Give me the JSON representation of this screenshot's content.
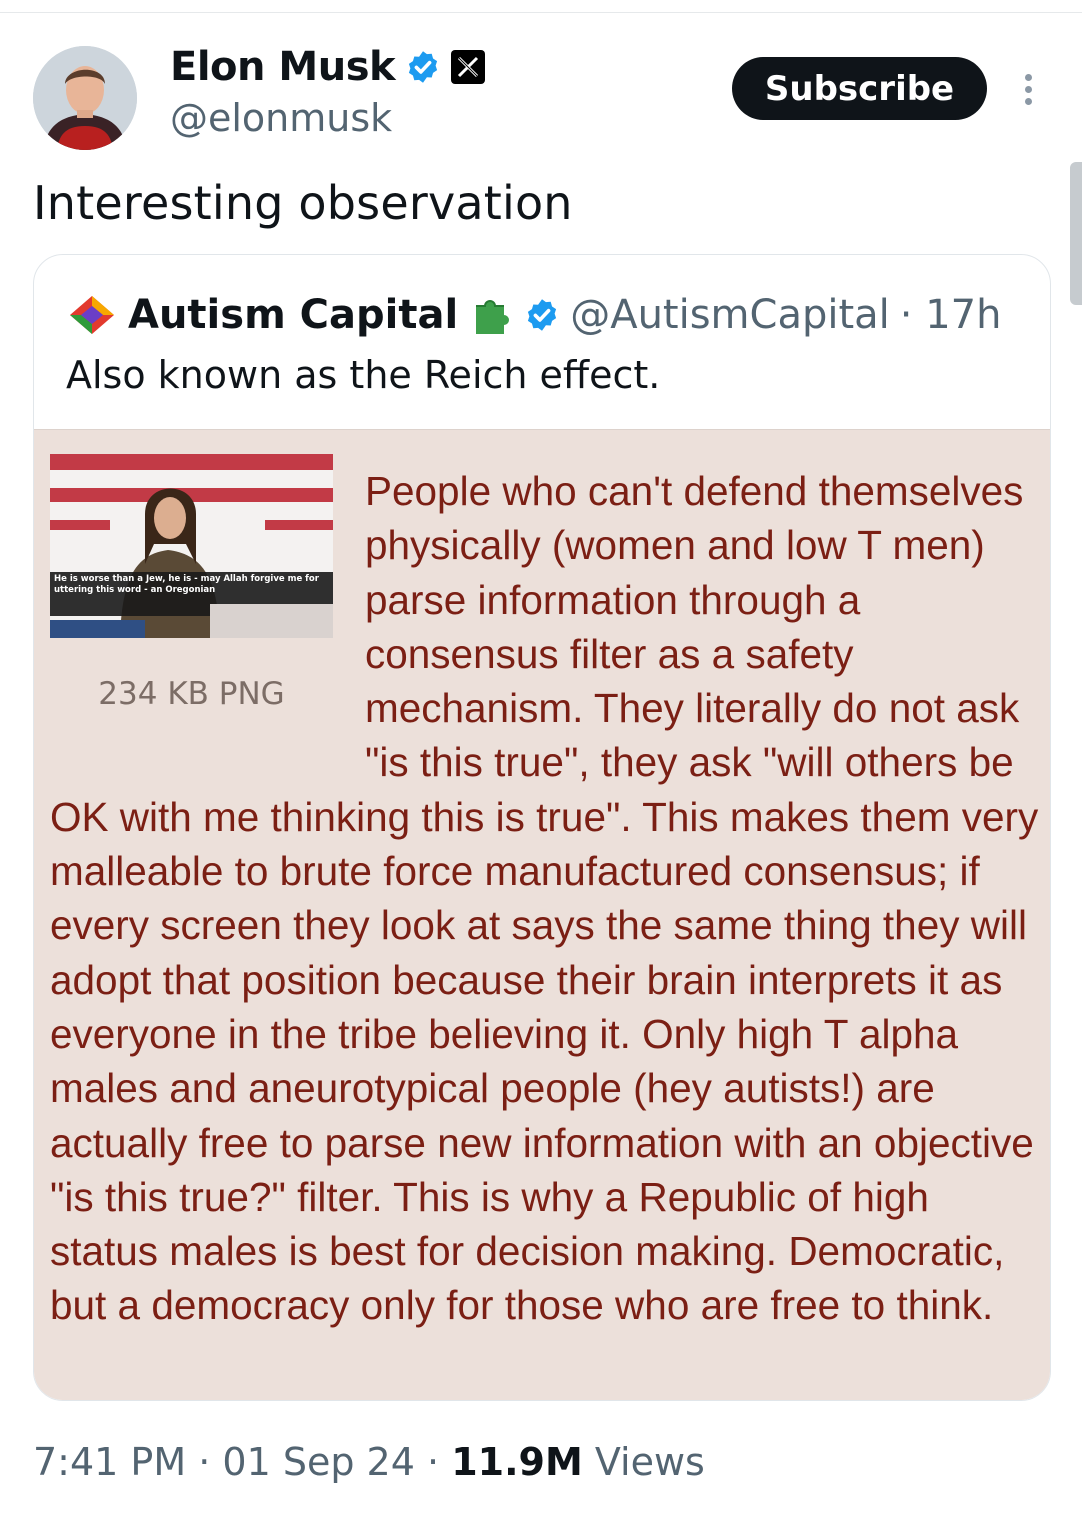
{
  "author": {
    "name": "Elon Musk",
    "handle": "@elonmusk"
  },
  "actions": {
    "subscribe_label": "Subscribe"
  },
  "tweet": {
    "text": "Interesting observation",
    "time": "7:41 PM",
    "date": "01 Sep 24",
    "views_count": "11.9M",
    "views_label": "Views",
    "separator": "·"
  },
  "quote": {
    "name": "Autism Capital",
    "handle": "@AutismCapital",
    "age": "· 17h",
    "text": "Also known as the Reich effect.",
    "image": {
      "file_info": "234 KB PNG",
      "thumbnail_caption": "He is worse than a Jew, he is - may Allah forgive me for uttering this word - an Oregonian",
      "post_text": "People who can't defend themselves physically (women and low T men) parse information through a consensus filter as a safety mechanism. They literally do not ask \"is this true\", they ask \"will others be OK with me thinking this is true\". This makes them very malleable to brute force manufactured consensus; if every screen they look at says the same thing they will adopt that position because their brain interprets it as everyone in the tribe believing it. Only high T alpha males and aneurotypical people (hey autists!) are actually free to parse new information with an objective \"is this true?\" filter. This is why a Republic of high status males is best for decision making. Democratic, but a democracy only for those who are free to think."
    }
  },
  "colors": {
    "verified_blue": "#1d9bf0",
    "greentext_bg": "#ece0da",
    "greentext_fg": "#7b1f14"
  }
}
